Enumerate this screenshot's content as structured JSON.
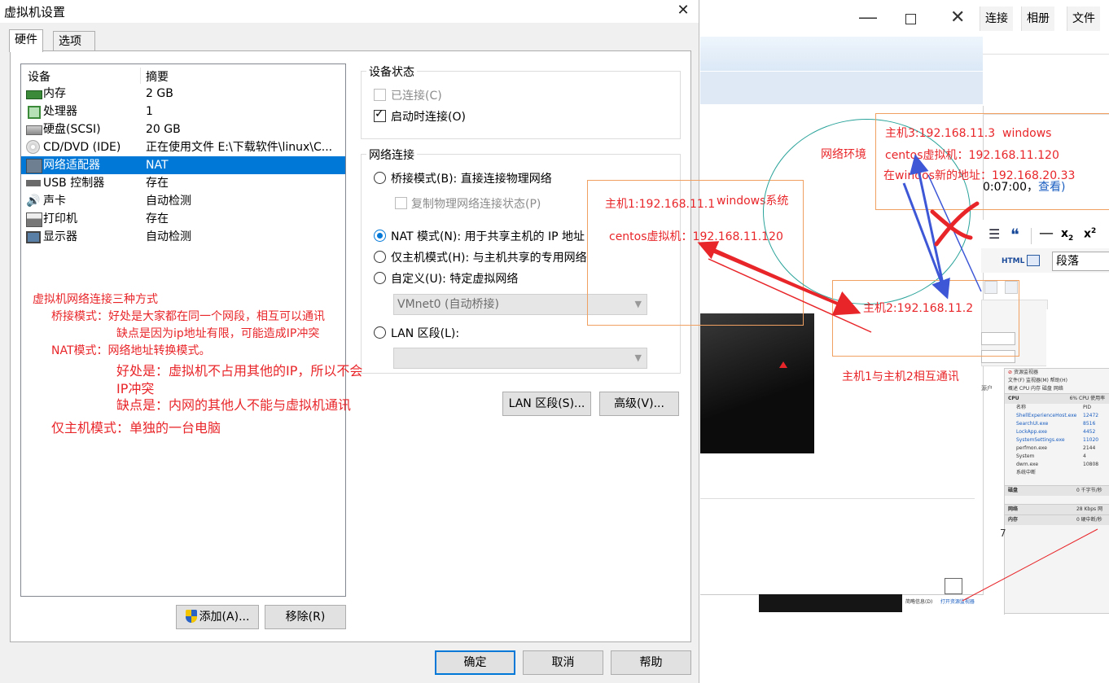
{
  "dialog": {
    "title": "虚拟机设置",
    "tabs": [
      {
        "label": "硬件",
        "active": true
      },
      {
        "label": "选项",
        "active": false
      }
    ],
    "device_list": {
      "columns": [
        "设备",
        "摘要"
      ],
      "rows": [
        {
          "icon": "memory-icon",
          "name": "内存",
          "summary": "2 GB"
        },
        {
          "icon": "processor-icon",
          "name": "处理器",
          "summary": "1"
        },
        {
          "icon": "hard-disk-icon",
          "name": "硬盘(SCSI)",
          "summary": "20 GB"
        },
        {
          "icon": "cd-dvd-icon",
          "name": "CD/DVD (IDE)",
          "summary": "正在使用文件 E:\\下载软件\\linux\\C..."
        },
        {
          "icon": "network-adapter-icon",
          "name": "网络适配器",
          "summary": "NAT",
          "selected": true
        },
        {
          "icon": "usb-icon",
          "name": "USB 控制器",
          "summary": "存在"
        },
        {
          "icon": "sound-card-icon",
          "name": "声卡",
          "summary": "自动检测"
        },
        {
          "icon": "printer-icon",
          "name": "打印机",
          "summary": "存在"
        },
        {
          "icon": "monitor-icon",
          "name": "显示器",
          "summary": "自动检测"
        }
      ]
    },
    "add_button": "添加(A)...",
    "remove_button": "移除(R)",
    "device_status": {
      "title": "设备状态",
      "connected": {
        "label": "已连接(C)",
        "checked": false,
        "disabled": true
      },
      "connect_at_power_on": {
        "label": "启动时连接(O)",
        "checked": true
      }
    },
    "network": {
      "title": "网络连接",
      "bridged": "桥接模式(B): 直接连接物理网络",
      "replicate": "复制物理网络连接状态(P)",
      "nat": "NAT 模式(N): 用于共享主机的 IP 地址",
      "host_only": "仅主机模式(H): 与主机共享的专用网络",
      "custom": "自定义(U): 特定虚拟网络",
      "custom_value": "VMnet0 (自动桥接)",
      "lan_segment": "LAN 区段(L):",
      "lan_value": "",
      "selected": "nat"
    },
    "lan_segments_button": "LAN 区段(S)...",
    "advanced_button": "高级(V)...",
    "ok_button": "确定",
    "cancel_button": "取消",
    "help_button": "帮助"
  },
  "annotations": {
    "heading": "虚拟机网络连接三种方式",
    "bridge_line": "桥接模式：好处是大家都在同一个网段，相互可以通讯",
    "bridge_con": "缺点是因为ip地址有限，可能造成IP冲突",
    "nat_line": "NAT模式：网络地址转换模式。",
    "nat_pro_1": "好处是：虚拟机不占用其他的IP，所以不会",
    "nat_pro_2": "IP冲突",
    "nat_con": "缺点是：内网的其他人不能与虚拟机通讯",
    "host_only": "仅主机模式：单独的一台电脑",
    "host1_ip": "主机1:192.168.11.1",
    "host1_os": "windows系统",
    "host1_vm": "centos虚拟机：192.168.11.120",
    "network_env": "网络环境",
    "host3_ip": "主机3:192.168.11.3",
    "host3_os": "windows",
    "host3_vm": "centos虚拟机：192.168.11.120",
    "host3_new": "在windos新的地址：192.168.20.33",
    "host2_ip": "主机2:192.168.11.2",
    "comm_note": "主机1与主机2相互通讯"
  },
  "background_window": {
    "menu": [
      "连接",
      "相册",
      "文件"
    ],
    "partial_text": "0:07:00，",
    "partial_link": "查看)",
    "paragraph_select": "段落",
    "html_label": "HTML",
    "resource_monitor": {
      "title": "资源监视器",
      "menu": "文件(F)  监视器(M)  帮助(H)",
      "tabs": "概述  CPU  内存  磁盘  网络",
      "cpu_header": "CPU",
      "cpu_usage": "6% CPU 使用率",
      "columns": [
        "名称",
        "PID"
      ],
      "processes": [
        {
          "name": "ShellExperienceHost.exe",
          "pid": "12472"
        },
        {
          "name": "SearchUI.exe",
          "pid": "8516"
        },
        {
          "name": "LockApp.exe",
          "pid": "4452"
        },
        {
          "name": "SystemSettings.exe",
          "pid": "11020"
        },
        {
          "name": "perfmon.exe",
          "pid": "2144"
        },
        {
          "name": "System",
          "pid": "4"
        },
        {
          "name": "dwm.exe",
          "pid": "10808"
        },
        {
          "name": "系统中断",
          "pid": ""
        }
      ],
      "disk": "磁盘",
      "disk_val": "0 千字节/秒",
      "network": "网络",
      "network_val": "28 Kbps 网",
      "memory": "内存",
      "memory_val": "0 硬中断/秒",
      "footer_left": "简略信息(D)",
      "footer_link": "打开资源监视器"
    }
  }
}
